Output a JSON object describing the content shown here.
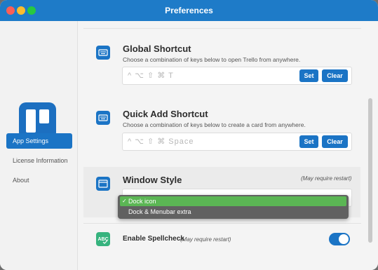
{
  "window": {
    "title": "Preferences"
  },
  "sidebar": {
    "items": [
      {
        "label": "App Settings",
        "active": true
      },
      {
        "label": "License Information",
        "active": false
      },
      {
        "label": "About",
        "active": false
      }
    ]
  },
  "settings": {
    "global_shortcut": {
      "title": "Global Shortcut",
      "description": "Choose a combination of keys below to open Trello from anywhere.",
      "keys": "^ ⌥ ⇧ ⌘ T",
      "set_label": "Set",
      "clear_label": "Clear"
    },
    "quick_add_shortcut": {
      "title": "Quick Add Shortcut",
      "description": "Choose a combination of keys below to create a card from anywhere.",
      "keys": "^ ⌥ ⇧ ⌘ Space",
      "set_label": "Set",
      "clear_label": "Clear"
    },
    "window_style": {
      "title": "Window Style",
      "note": "(May require restart)",
      "options": [
        "Dock icon",
        "Dock & Menubar extra"
      ],
      "selected": "Dock icon"
    },
    "spellcheck": {
      "title": "Enable Spellcheck",
      "note": "(May require restart)",
      "enabled": true
    }
  },
  "colors": {
    "accent": "#1b74c5",
    "selected_option": "#5bb654",
    "spellcheck_icon": "#36b37e"
  },
  "icons": [
    "keyboard-icon",
    "window-icon",
    "spellcheck-icon",
    "trello-logo",
    "checkmark-icon"
  ]
}
